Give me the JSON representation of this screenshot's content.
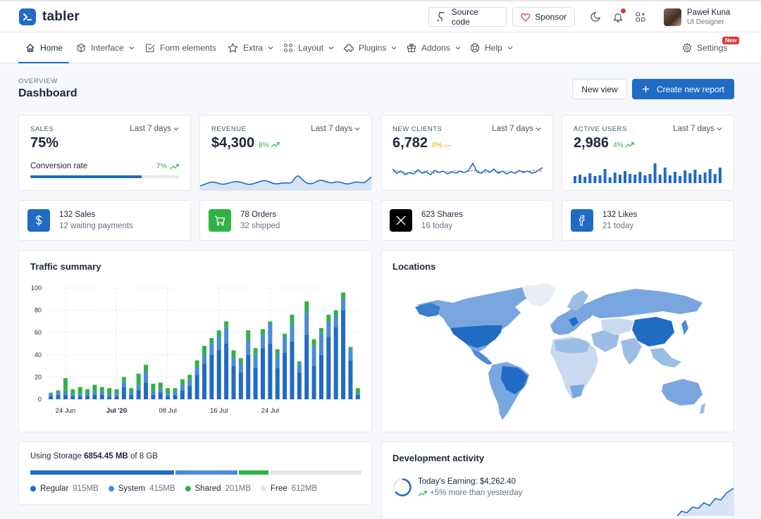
{
  "app": {
    "name": "tabler"
  },
  "topbar": {
    "source_label": "Source code",
    "sponsor_label": "Sponsor"
  },
  "user": {
    "name": "Paweł Kuna",
    "role": "UI Designer"
  },
  "nav": [
    {
      "label": "Home",
      "icon": "home-icon",
      "dropdown": false
    },
    {
      "label": "Interface",
      "icon": "package-icon",
      "dropdown": true
    },
    {
      "label": "Form elements",
      "icon": "checkbox-icon",
      "dropdown": false
    },
    {
      "label": "Extra",
      "icon": "star-icon",
      "dropdown": true
    },
    {
      "label": "Layout",
      "icon": "layout-grid-icon",
      "dropdown": true
    },
    {
      "label": "Plugins",
      "icon": "puzzle-icon",
      "dropdown": true
    },
    {
      "label": "Addons",
      "icon": "gift-icon",
      "dropdown": true
    },
    {
      "label": "Help",
      "icon": "lifebuoy-icon",
      "dropdown": true
    }
  ],
  "settings": {
    "label": "Settings",
    "badge": "New"
  },
  "page": {
    "pretitle": "OVERVIEW",
    "title": "Dashboard",
    "new_view": "New view",
    "create_report": "Create new report"
  },
  "colors": {
    "primary": "#206bc4",
    "green": "#2fb344",
    "red": "#d63939",
    "orange": "#f59f00"
  },
  "stats": {
    "sales": {
      "label": "SALES",
      "period": "Last 7 days",
      "value": "75%",
      "conversion_label": "Conversion rate",
      "conversion_delta": "7%",
      "progress": 0.75
    },
    "revenue": {
      "label": "REVENUE",
      "period": "Last 7 days",
      "value": "$4,300",
      "delta": "8%"
    },
    "clients": {
      "label": "NEW CLIENTS",
      "period": "Last 7 days",
      "value": "6,782",
      "delta": "0%"
    },
    "users": {
      "label": "ACTIVE USERS",
      "period": "Last 7 days",
      "value": "2,986",
      "delta": "4%"
    }
  },
  "mini": {
    "sales": {
      "l1": "132 Sales",
      "l2": "12 waiting payments",
      "icon": "dollar-icon"
    },
    "orders": {
      "l1": "78 Orders",
      "l2": "32 shipped",
      "icon": "cart-icon"
    },
    "shares": {
      "l1": "623 Shares",
      "l2": "16 today",
      "icon": "x-brand-icon"
    },
    "likes": {
      "l1": "132 Likes",
      "l2": "21 today",
      "icon": "facebook-icon"
    }
  },
  "traffic": {
    "title": "Traffic summary"
  },
  "locations": {
    "title": "Locations"
  },
  "storage": {
    "prefix": "Using Storage",
    "used": "6854.45 MB",
    "of": "of",
    "total": "8 GB",
    "segments": [
      {
        "name": "Regular",
        "value": "915MB",
        "color": "#206bc4",
        "share": 0.44
      },
      {
        "name": "System",
        "value": "415MB",
        "color": "#4a8bd6",
        "share": 0.19
      },
      {
        "name": "Shared",
        "value": "201MB",
        "color": "#2fb344",
        "share": 0.09
      },
      {
        "name": "Free",
        "value": "612MB",
        "color": "#e6e7e9",
        "share": 0.28
      }
    ]
  },
  "dev": {
    "title": "Development activity",
    "earning": "Today's Earning: $4,262.40",
    "earning_delta": "+5% more than yesterday"
  },
  "chart_data": {
    "type": "bar",
    "stacked": true,
    "ylim": [
      0,
      100
    ],
    "yticks": [
      0,
      20,
      40,
      60,
      80,
      100
    ],
    "xticks": [
      {
        "index": 2,
        "label": "24 Jun"
      },
      {
        "index": 9,
        "label": "Jul '20"
      },
      {
        "index": 16,
        "label": "08 Jul"
      },
      {
        "index": 23,
        "label": "16 Jul"
      },
      {
        "index": 30,
        "label": "24 Jul"
      }
    ],
    "series": [
      {
        "color": "#206bc4",
        "values": [
          3,
          4,
          4,
          3,
          3,
          3,
          4,
          4,
          3,
          3,
          11,
          4,
          8,
          15,
          4,
          6,
          3,
          4,
          8,
          12,
          22,
          32,
          40,
          44,
          50,
          30,
          24,
          40,
          28,
          46,
          50,
          28,
          42,
          52,
          24,
          58,
          30,
          40,
          56,
          65,
          80,
          35,
          4
        ]
      },
      {
        "color": "#4a8bd6",
        "values": [
          2,
          2,
          3,
          2,
          2,
          3,
          3,
          3,
          2,
          2,
          5,
          3,
          5,
          10,
          3,
          4,
          2,
          3,
          5,
          6,
          7,
          8,
          10,
          12,
          15,
          8,
          8,
          14,
          12,
          12,
          18,
          12,
          14,
          16,
          8,
          20,
          18,
          20,
          14,
          10,
          10,
          10,
          2
        ]
      },
      {
        "color": "#2fb344",
        "values": [
          1,
          2,
          12,
          4,
          6,
          3,
          6,
          4,
          5,
          4,
          4,
          3,
          10,
          6,
          7,
          5,
          5,
          3,
          5,
          4,
          6,
          8,
          5,
          6,
          5,
          6,
          5,
          8,
          6,
          5,
          2,
          5,
          3,
          8,
          2,
          10,
          6,
          4,
          6,
          5,
          6,
          2,
          4
        ]
      }
    ]
  }
}
